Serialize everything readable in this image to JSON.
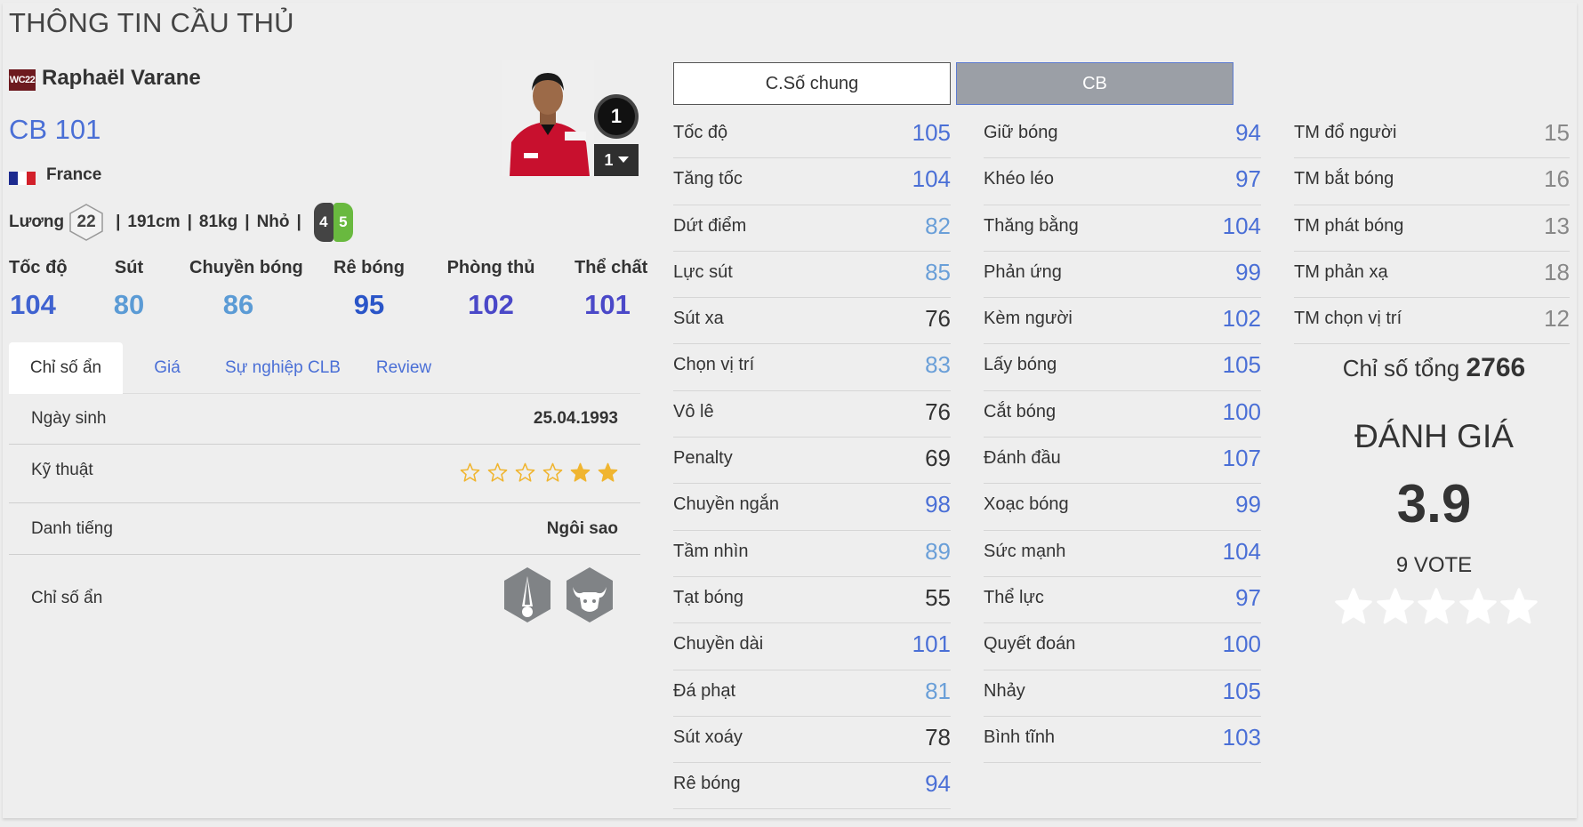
{
  "page_title": "THÔNG TIN CẦU THỦ",
  "player": {
    "season": "WC22",
    "name": "Raphaël Varane",
    "position_rating": "CB 101",
    "nation": "France",
    "salary_label": "Lương",
    "salary": "22",
    "height": "191cm",
    "weight": "81kg",
    "body_type": "Nhỏ",
    "sep": "|",
    "foot_left": "4",
    "foot_right": "5",
    "rank": "1",
    "level": "1"
  },
  "main_stats": [
    {
      "label": "Tốc độ",
      "value": "104",
      "color": "#3f62d0"
    },
    {
      "label": "Sút",
      "value": "80",
      "color": "#5b9bd5"
    },
    {
      "label": "Chuyền bóng",
      "value": "86",
      "color": "#5b9bd5"
    },
    {
      "label": "Rê bóng",
      "value": "95",
      "color": "#2a55c8"
    },
    {
      "label": "Phòng thủ",
      "value": "102",
      "color": "#4a48c8"
    },
    {
      "label": "Thể chất",
      "value": "101",
      "color": "#4a48c8"
    }
  ],
  "tabs": [
    "Chỉ số ẩn",
    "Giá",
    "Sự nghiệp CLB",
    "Review"
  ],
  "info": {
    "birth_label": "Ngày sinh",
    "birth_value": "25.04.1993",
    "skill_label": "Kỹ thuật",
    "skill_stars": 2,
    "skill_max": 6,
    "fame_label": "Danh tiếng",
    "fame_value": "Ngôi sao",
    "hidden_label": "Chỉ số ẩn",
    "traits": [
      "long-throw-trait-icon",
      "bull-power-header-trait-icon"
    ]
  },
  "stat_tabs": [
    "C.Số chung",
    "CB"
  ],
  "stats_col1": [
    {
      "name": "Tốc độ",
      "value": "105",
      "color": "#4a6fd6"
    },
    {
      "name": "Tăng tốc",
      "value": "104",
      "color": "#4a6fd6"
    },
    {
      "name": "Dứt điểm",
      "value": "82",
      "color": "#6a9fd8"
    },
    {
      "name": "Lực sút",
      "value": "85",
      "color": "#6a9fd8"
    },
    {
      "name": "Sút xa",
      "value": "76",
      "color": "#333333"
    },
    {
      "name": "Chọn vị trí",
      "value": "83",
      "color": "#6a9fd8"
    },
    {
      "name": "Vô lê",
      "value": "76",
      "color": "#333333"
    },
    {
      "name": "Penalty",
      "value": "69",
      "color": "#333333"
    },
    {
      "name": "Chuyền ngắn",
      "value": "98",
      "color": "#4a6fd6"
    },
    {
      "name": "Tầm nhìn",
      "value": "89",
      "color": "#6a9fd8"
    },
    {
      "name": "Tạt bóng",
      "value": "55",
      "color": "#333333"
    },
    {
      "name": "Chuyền dài",
      "value": "101",
      "color": "#4a6fd6"
    },
    {
      "name": "Đá phạt",
      "value": "81",
      "color": "#6a9fd8"
    },
    {
      "name": "Sút xoáy",
      "value": "78",
      "color": "#333333"
    },
    {
      "name": "Rê bóng",
      "value": "94",
      "color": "#4a6fd6"
    }
  ],
  "stats_col2": [
    {
      "name": "Giữ bóng",
      "value": "94",
      "color": "#4a6fd6"
    },
    {
      "name": "Khéo léo",
      "value": "97",
      "color": "#4a6fd6"
    },
    {
      "name": "Thăng bằng",
      "value": "104",
      "color": "#4a6fd6"
    },
    {
      "name": "Phản ứng",
      "value": "99",
      "color": "#4a6fd6"
    },
    {
      "name": "Kèm người",
      "value": "102",
      "color": "#4a6fd6"
    },
    {
      "name": "Lấy bóng",
      "value": "105",
      "color": "#4a6fd6"
    },
    {
      "name": "Cắt bóng",
      "value": "100",
      "color": "#4a6fd6"
    },
    {
      "name": "Đánh đầu",
      "value": "107",
      "color": "#4a6fd6"
    },
    {
      "name": "Xoạc bóng",
      "value": "99",
      "color": "#4a6fd6"
    },
    {
      "name": "Sức mạnh",
      "value": "104",
      "color": "#4a6fd6"
    },
    {
      "name": "Thể lực",
      "value": "97",
      "color": "#4a6fd6"
    },
    {
      "name": "Quyết đoán",
      "value": "100",
      "color": "#4a6fd6"
    },
    {
      "name": "Nhảy",
      "value": "105",
      "color": "#4a6fd6"
    },
    {
      "name": "Bình tĩnh",
      "value": "103",
      "color": "#4a6fd6"
    }
  ],
  "stats_col3": [
    {
      "name": "TM đổ người",
      "value": "15",
      "color": "#888888"
    },
    {
      "name": "TM bắt bóng",
      "value": "16",
      "color": "#888888"
    },
    {
      "name": "TM phát bóng",
      "value": "13",
      "color": "#888888"
    },
    {
      "name": "TM phản xạ",
      "value": "18",
      "color": "#888888"
    },
    {
      "name": "TM chọn vị trí",
      "value": "12",
      "color": "#888888"
    }
  ],
  "summary": {
    "total_label": "Chỉ số tổng",
    "total_value": "2766",
    "rating_title": "ĐÁNH GIÁ",
    "rating_value": "3.9",
    "votes": "9 VOTE",
    "rating_stars": 5
  }
}
